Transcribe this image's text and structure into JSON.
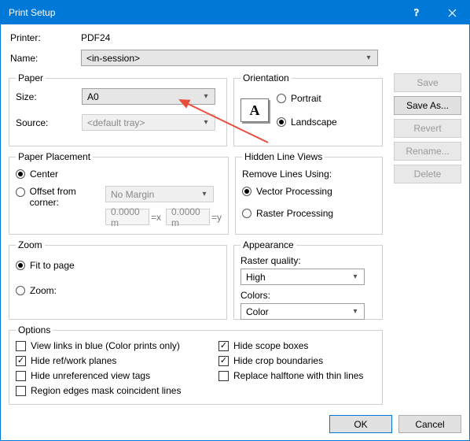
{
  "window_title": "Print Setup",
  "printer_label": "Printer:",
  "printer_value": "PDF24",
  "name_label": "Name:",
  "name_value": "<in-session>",
  "paper": {
    "legend": "Paper",
    "size_label": "Size:",
    "size_value": "A0",
    "source_label": "Source:",
    "source_value": "<default tray>"
  },
  "orientation": {
    "legend": "Orientation",
    "portrait": "Portrait",
    "landscape": "Landscape",
    "icon_glyph": "A"
  },
  "placement": {
    "legend": "Paper Placement",
    "center": "Center",
    "offset": "Offset from corner:",
    "margin_value": "No Margin",
    "x_value": "0.0000 m",
    "x_suffix": "=x",
    "y_value": "0.0000 m",
    "y_suffix": "=y"
  },
  "hidden": {
    "legend": "Hidden Line Views",
    "sub": "Remove Lines Using:",
    "vector": "Vector Processing",
    "raster": "Raster Processing"
  },
  "zoom": {
    "legend": "Zoom",
    "fit": "Fit to page",
    "zoom": "Zoom:"
  },
  "appearance": {
    "legend": "Appearance",
    "raster_label": "Raster quality:",
    "raster_value": "High",
    "colors_label": "Colors:",
    "colors_value": "Color"
  },
  "options": {
    "legend": "Options",
    "view_links": "View links in blue (Color prints only)",
    "hide_ref": "Hide ref/work planes",
    "hide_unref": "Hide unreferenced view tags",
    "region_edges": "Region edges mask coincident lines",
    "hide_scope": "Hide scope boxes",
    "hide_crop": "Hide crop boundaries",
    "replace_halftone": "Replace halftone with thin lines"
  },
  "side": {
    "save": "Save",
    "save_as": "Save As...",
    "revert": "Revert",
    "rename": "Rename...",
    "delete": "Delete"
  },
  "bottom": {
    "ok": "OK",
    "cancel": "Cancel"
  }
}
